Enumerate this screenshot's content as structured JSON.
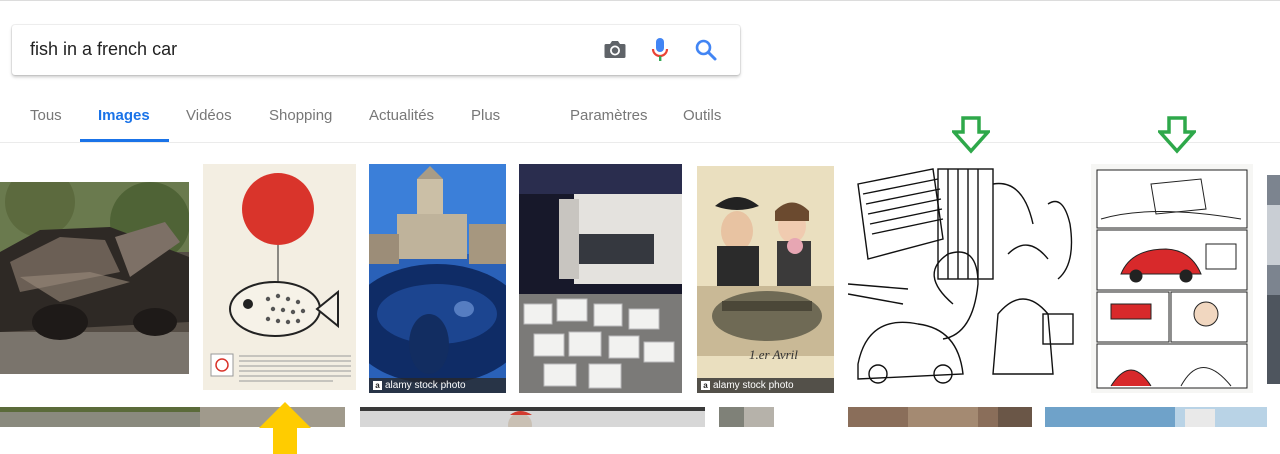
{
  "search": {
    "query": "fish in a french car"
  },
  "icons": {
    "camera": "camera-icon",
    "mic": "microphone-icon",
    "search": "search-icon"
  },
  "tabs": [
    {
      "label": "Tous",
      "active": false
    },
    {
      "label": "Images",
      "active": true
    },
    {
      "label": "Vidéos",
      "active": false
    },
    {
      "label": "Shopping",
      "active": false
    },
    {
      "label": "Actualités",
      "active": false
    },
    {
      "label": "Plus",
      "active": false
    },
    {
      "label": "Paramètres",
      "active": false
    },
    {
      "label": "Outils",
      "active": false
    }
  ],
  "results": {
    "watermark_text": "alamy stock photo",
    "watermark_letter": "a",
    "postcard_caption": "1.er Avril",
    "overlay_alamy": "alamy"
  },
  "annotations": {
    "down_arrow_color": "#2ea84a",
    "up_arrow_color": "#ffcc00"
  },
  "colors": {
    "accent": "#1a73e8",
    "mic_red": "#ea4335",
    "mic_blue": "#4285f4",
    "camera_gray": "#5f6368",
    "balloon_red": "#d9342b"
  }
}
